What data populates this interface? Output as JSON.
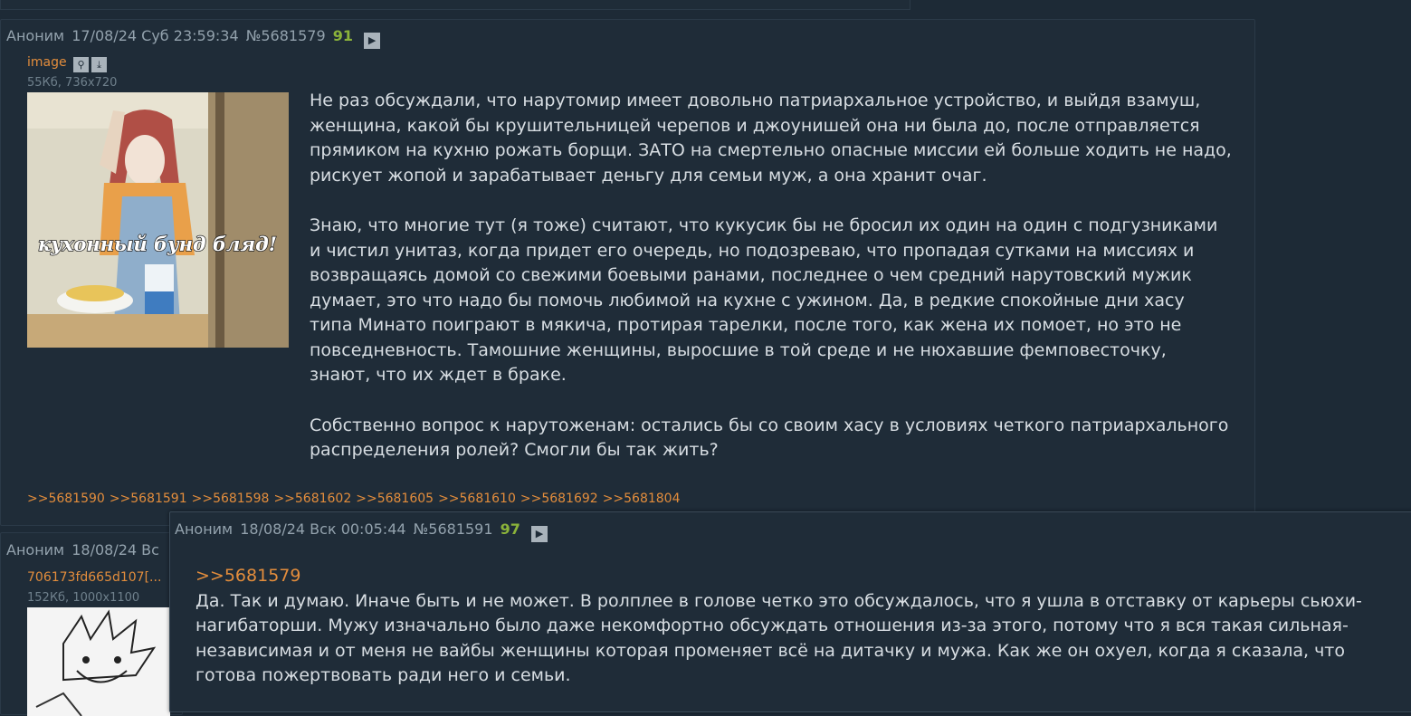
{
  "post1": {
    "author": "Аноним",
    "date": "17/08/24 Суб 23:59:34",
    "number": "№5681579",
    "rating": "91",
    "file": {
      "name": "image",
      "meta": "55Кб, 736x720",
      "caption": "кухонный бунд бляд!"
    },
    "paragraphs": [
      "Не раз обсуждали, что нарутомир имеет довольно патриархальное устройство, и выйдя взамуш, женщина, какой бы крушительницей черепов и джоунишей она ни была до, после отправляется прямиком на кухню рожать борщи. ЗАТО на смертельно опасные миссии ей больше ходить не надо, рискует жопой и зарабатывает деньгу для семьи муж, а она хранит очаг.",
      "Знаю, что многие тут (я тоже) считают, что кукусик бы не бросил их один на один с подгузниками и чистил унитаз, когда придет его очередь, но подозреваю, что пропадая сутками на миссиях и возвращаясь домой со свежими боевыми ранами, последнее о чем средний нарутовский мужик думает, это что надо бы помочь любимой на кухне с ужином. Да, в редкие спокойные дни хасу типа Минато поиграют в мякича, протирая тарелки, после того, как жена их помоет, но это не повседневность. Тамошние женщины, выросшие в той среде и не нюхавшие фемповесточку, знают, что их ждет в браке.",
      "Собственно вопрос к нарутоженам: остались бы со своим хасу в условиях четкого патриархального распределения ролей? Смогли бы так жить?"
    ],
    "replies": [
      ">>5681590",
      ">>5681591",
      ">>5681598",
      ">>5681602",
      ">>5681605",
      ">>5681610",
      ">>5681692",
      ">>5681804"
    ]
  },
  "post2": {
    "author": "Аноним",
    "date_partial": "18/08/24 Вс",
    "file": {
      "name": "706173fd665d107[...",
      "meta": "152Кб, 1000x1100"
    }
  },
  "post3": {
    "author": "Аноним",
    "date": "18/08/24 Вск 00:05:44",
    "number": "№5681591",
    "rating": "97",
    "quote": ">>5681579",
    "text": "Да. Так и думаю. Иначе быть и не может. В ролплее в голове четко это обсуждалось, что я ушла в отставку от карьеры сьюхи-нагибаторши. Мужу изначально было даже некомфортно обсуждать отношения из-за этого, потому что я вся такая сильная-независимая и от меня не вайбы женщины которая променяет всё на дитачку и мужа. Как же он охуел, когда я сказала, что готова пожертвовать ради него и семьи."
  },
  "colors": {
    "background": "#1d2a36",
    "post_bg": "#1f2c38",
    "link": "#e38d3c",
    "rating": "#8bb33a",
    "meta": "#93a2ad"
  }
}
